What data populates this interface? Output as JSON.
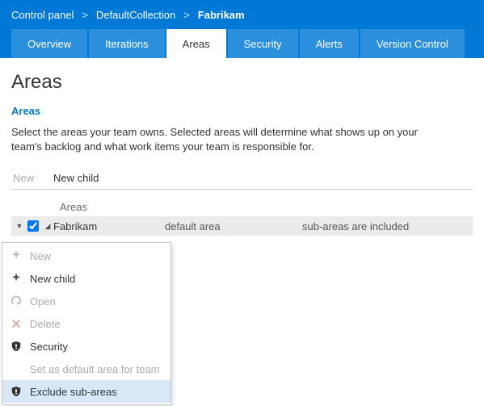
{
  "breadcrumb": {
    "a": "Control panel",
    "b": "DefaultCollection",
    "c": "Fabrikam"
  },
  "tabs": {
    "overview": "Overview",
    "iterations": "Iterations",
    "areas": "Areas",
    "security": "Security",
    "alerts": "Alerts",
    "vc": "Version Control"
  },
  "page": {
    "title": "Areas",
    "section": "Areas",
    "desc": "Select the areas your team owns. Selected areas will determine what shows up on your team's backlog and what work items your team is responsible for."
  },
  "toolbar": {
    "new": "New",
    "newchild": "New child"
  },
  "grid": {
    "header": "Areas",
    "row": {
      "name": "Fabrikam",
      "default": "default area",
      "sub": "sub-areas are included"
    }
  },
  "menu": {
    "new": "New",
    "newchild": "New child",
    "open": "Open",
    "delete": "Delete",
    "security": "Security",
    "setdefault": "Set as default area for team",
    "exclude": "Exclude sub-areas"
  }
}
